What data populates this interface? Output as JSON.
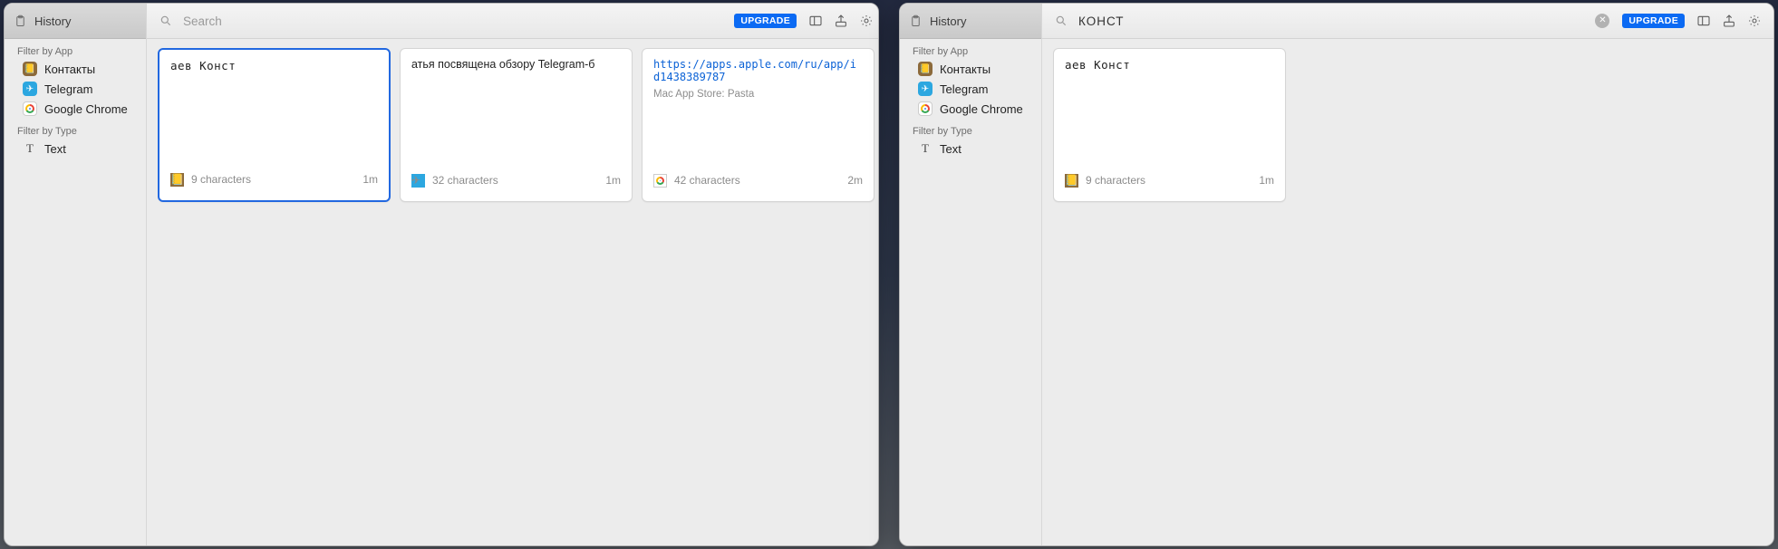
{
  "sidebar": {
    "title": "History",
    "filter_app_label": "Filter by App",
    "apps": [
      {
        "name": "Контакты",
        "icon": "contacts"
      },
      {
        "name": "Telegram",
        "icon": "telegram"
      },
      {
        "name": "Google Chrome",
        "icon": "chrome"
      }
    ],
    "filter_type_label": "Filter by Type",
    "types": [
      {
        "name": "Text",
        "glyph": "T"
      }
    ]
  },
  "toolbar": {
    "search_placeholder": "Search",
    "upgrade_label": "UPGRADE"
  },
  "windows": [
    {
      "search_value": "",
      "show_clear": false,
      "cards": [
        {
          "selected": true,
          "body_text": "аев Конст",
          "body_mono": true,
          "link": "",
          "subtitle": "",
          "app_icon": "contacts",
          "meta": "9 characters",
          "age": "1m"
        },
        {
          "selected": false,
          "body_text": "атья посвящена обзору Telegram-б",
          "body_mono": false,
          "link": "",
          "subtitle": "",
          "app_icon": "telegram",
          "meta": "32 characters",
          "age": "1m"
        },
        {
          "selected": false,
          "body_text": "",
          "body_mono": false,
          "link": "https://apps.apple.com/ru/app/id1438389787",
          "subtitle": "Mac App Store: Pasta",
          "app_icon": "chrome",
          "meta": "42 characters",
          "age": "2m"
        }
      ]
    },
    {
      "search_value": "конст",
      "show_clear": true,
      "cards": [
        {
          "selected": false,
          "body_text": "аев Конст",
          "body_mono": true,
          "link": "",
          "subtitle": "",
          "app_icon": "contacts",
          "meta": "9 characters",
          "age": "1m"
        }
      ]
    }
  ]
}
